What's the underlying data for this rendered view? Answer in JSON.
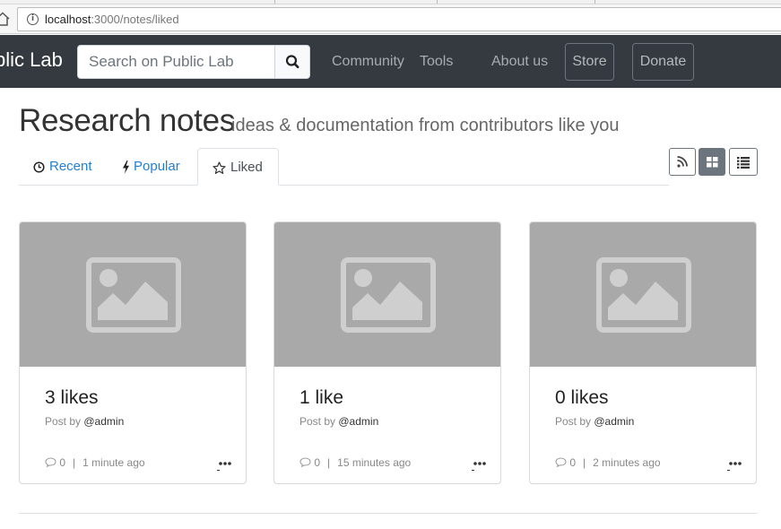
{
  "browser": {
    "url_host": "localhost",
    "url_path": ":3000/notes/liked"
  },
  "navbar": {
    "brand": "blic Lab",
    "search_placeholder": "Search on Public Lab",
    "links": [
      "Community",
      "Tools",
      "About us"
    ],
    "store_label": "Store",
    "donate_label": "Donate"
  },
  "header": {
    "title": "Research notes",
    "subtitle": "ideas & documentation from contributors like you"
  },
  "tabs": [
    {
      "label": "Recent",
      "icon": "clock-icon",
      "active": false
    },
    {
      "label": "Popular",
      "icon": "bolt-icon",
      "active": false
    },
    {
      "label": "Liked",
      "icon": "star-icon",
      "active": true
    }
  ],
  "view_buttons": [
    {
      "icon": "rss-icon",
      "active": false
    },
    {
      "icon": "grid-icon",
      "active": true
    },
    {
      "icon": "list-icon",
      "active": false
    }
  ],
  "cards": [
    {
      "title": "3 likes",
      "post_by": "Post by",
      "author": "@admin",
      "comments": "0",
      "time": "1 minute ago"
    },
    {
      "title": "1 like",
      "post_by": "Post by",
      "author": "@admin",
      "comments": "0",
      "time": "15 minutes ago"
    },
    {
      "title": "0 likes",
      "post_by": "Post by",
      "author": "@admin",
      "comments": "0",
      "time": "2 minutes ago"
    }
  ],
  "colors": {
    "navbar_bg": "#343a40",
    "link_blue": "#1f7fd6",
    "placeholder_gray": "#a9a9a9"
  }
}
